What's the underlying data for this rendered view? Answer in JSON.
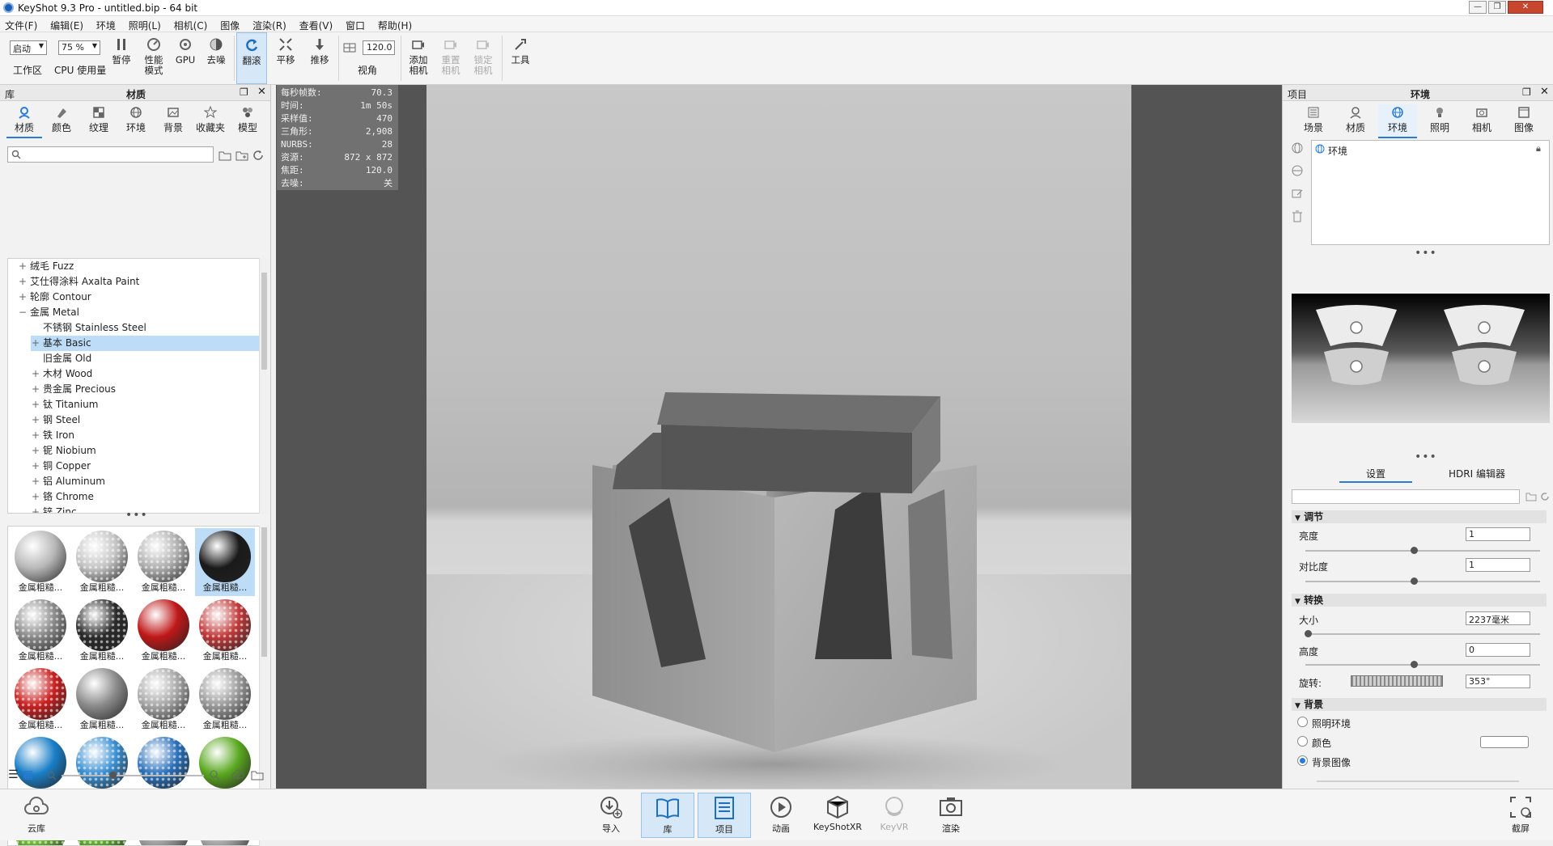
{
  "window": {
    "title": "KeyShot 9.3 Pro  - untitled.bip  - 64 bit"
  },
  "menu": [
    "文件(F)",
    "编辑(E)",
    "环境",
    "照明(L)",
    "相机(C)",
    "图像",
    "渲染(R)",
    "查看(V)",
    "窗口",
    "帮助(H)"
  ],
  "toolbar": {
    "workspace_value": "启动",
    "workspace_label": "工作区",
    "cpu_value": "75 %",
    "cpu_label": "CPU 使用量",
    "pause": "暂停",
    "perf_mode_line1": "性能",
    "perf_mode_line2": "模式",
    "gpu": "GPU",
    "denoise": "去噪",
    "tumble": "翻滚",
    "pan": "平移",
    "dolly": "推移",
    "fov_value": "120.0",
    "fov_label": "视角",
    "add_camera_line1": "添加",
    "add_camera_line2": "相机",
    "reset_camera_line1": "重置",
    "reset_camera_line2": "相机",
    "lock_camera_line1": "锁定",
    "lock_camera_line2": "相机",
    "tools": "工具"
  },
  "library": {
    "header_left": "库",
    "header_title": "材质",
    "tabs": [
      "材质",
      "颜色",
      "纹理",
      "环境",
      "背景",
      "收藏夹",
      "模型"
    ],
    "search_placeholder": "",
    "tree": [
      {
        "indent": 0,
        "toggle": "+",
        "label": "绒毛 Fuzz",
        "selected": false
      },
      {
        "indent": 0,
        "toggle": "+",
        "label": "艾仕得涂料 Axalta Paint",
        "selected": false
      },
      {
        "indent": 0,
        "toggle": "+",
        "label": "轮廓 Contour",
        "selected": false
      },
      {
        "indent": 0,
        "toggle": "−",
        "label": "金属 Metal",
        "selected": false
      },
      {
        "indent": 1,
        "toggle": "",
        "label": "不锈钢 Stainless Steel",
        "selected": false
      },
      {
        "indent": 1,
        "toggle": "+",
        "label": "基本 Basic",
        "selected": true
      },
      {
        "indent": 1,
        "toggle": "",
        "label": "旧金属 Old",
        "selected": false
      },
      {
        "indent": 1,
        "toggle": "+",
        "label": "木材 Wood",
        "selected": false
      },
      {
        "indent": 1,
        "toggle": "+",
        "label": "贵金属 Precious",
        "selected": false
      },
      {
        "indent": 1,
        "toggle": "+",
        "label": "钛 Titanium",
        "selected": false
      },
      {
        "indent": 1,
        "toggle": "+",
        "label": "钢 Steel",
        "selected": false
      },
      {
        "indent": 1,
        "toggle": "+",
        "label": "铁 Iron",
        "selected": false
      },
      {
        "indent": 1,
        "toggle": "+",
        "label": "铌 Niobium",
        "selected": false
      },
      {
        "indent": 1,
        "toggle": "+",
        "label": "铜 Copper",
        "selected": false
      },
      {
        "indent": 1,
        "toggle": "+",
        "label": "铝 Aluminum",
        "selected": false
      },
      {
        "indent": 1,
        "toggle": "+",
        "label": "铬 Chrome",
        "selected": false
      },
      {
        "indent": 1,
        "toggle": "+",
        "label": "锌 Zinc",
        "selected": false
      }
    ],
    "thumbnails": [
      {
        "label": "金属粗糙...",
        "color": "#b8b8b8",
        "pattern": "plain",
        "selected": false
      },
      {
        "label": "金属粗糙...",
        "color": "#c4c4c4",
        "pattern": "dots",
        "selected": false
      },
      {
        "label": "金属粗糙...",
        "color": "#b0b0b0",
        "pattern": "dots",
        "selected": false
      },
      {
        "label": "金属粗糙...",
        "color": "#1a1a1a",
        "pattern": "plain",
        "selected": true
      },
      {
        "label": "金属粗糙...",
        "color": "#8a8a8a",
        "pattern": "dots",
        "selected": false
      },
      {
        "label": "金属粗糙...",
        "color": "#2a2a2a",
        "pattern": "dots",
        "selected": false
      },
      {
        "label": "金属粗糙...",
        "color": "#c01818",
        "pattern": "plain",
        "selected": false
      },
      {
        "label": "金属粗糙...",
        "color": "#c03a3a",
        "pattern": "dots",
        "selected": false
      },
      {
        "label": "金属粗糙...",
        "color": "#c82020",
        "pattern": "dots",
        "selected": false
      },
      {
        "label": "金属粗糙...",
        "color": "#8c8c8c",
        "pattern": "plain",
        "selected": false
      },
      {
        "label": "金属粗糙...",
        "color": "#a8a8a8",
        "pattern": "dots",
        "selected": false
      },
      {
        "label": "金属粗糙...",
        "color": "#9a9a9a",
        "pattern": "dots",
        "selected": false
      },
      {
        "label": "金属粗糙...",
        "color": "#1a7fc8",
        "pattern": "plain",
        "selected": false
      },
      {
        "label": "金属粗糙...",
        "color": "#3a8fd0",
        "pattern": "dots",
        "selected": false
      },
      {
        "label": "金属粗糙...",
        "color": "#2a70b8",
        "pattern": "dots",
        "selected": false
      },
      {
        "label": "金属粗糙...",
        "color": "#5aa820",
        "pattern": "plain",
        "selected": false
      },
      {
        "label": "",
        "color": "#6ab830",
        "pattern": "dots",
        "selected": false
      },
      {
        "label": "",
        "color": "#5cae28",
        "pattern": "dots",
        "selected": false
      },
      {
        "label": "",
        "color": "#a0a0a0",
        "pattern": "plain",
        "selected": false
      },
      {
        "label": "",
        "color": "#a8a8a8",
        "pattern": "plain",
        "selected": false
      }
    ]
  },
  "stats": [
    {
      "label": "每秒帧数:",
      "value": "70.3"
    },
    {
      "label": "时间:",
      "value": "1m 50s"
    },
    {
      "label": "采样值:",
      "value": "470"
    },
    {
      "label": "三角形:",
      "value": "2,908"
    },
    {
      "label": "NURBS:",
      "value": "28"
    },
    {
      "label": "资源:",
      "value": "872 x 872"
    },
    {
      "label": "焦距:",
      "value": "120.0"
    },
    {
      "label": "去噪:",
      "value": "关"
    }
  ],
  "project": {
    "header_left": "项目",
    "header_title": "环境",
    "tabs": [
      "场景",
      "材质",
      "环境",
      "照明",
      "相机",
      "图像"
    ],
    "active_tab": "环境",
    "env_list_item": "环境",
    "subtabs": [
      "设置",
      "HDRI 编辑器"
    ],
    "sections": {
      "adjust": "调节",
      "transform": "转换",
      "background": "背景"
    },
    "brightness_label": "亮度",
    "brightness_value": "1",
    "contrast_label": "对比度",
    "contrast_value": "1",
    "size_label": "大小",
    "size_value": "2237毫米",
    "height_label": "高度",
    "height_value": "0",
    "rotation_label": "旋转:",
    "rotation_value": "353°",
    "bg_options": [
      "照明环境",
      "颜色",
      "背景图像"
    ],
    "bg_selected": "背景图像"
  },
  "bottombar": {
    "cloud": "云库",
    "import": "导入",
    "library": "库",
    "project": "项目",
    "animation": "动画",
    "keyshotxr": "KeyShotXR",
    "keyvr": "KeyVR",
    "render": "渲染",
    "screenshot": "截屏"
  },
  "colors": {
    "accent": "#2a7bd4",
    "selection": "#bcdcf7",
    "viewport_bg": "#545454"
  }
}
